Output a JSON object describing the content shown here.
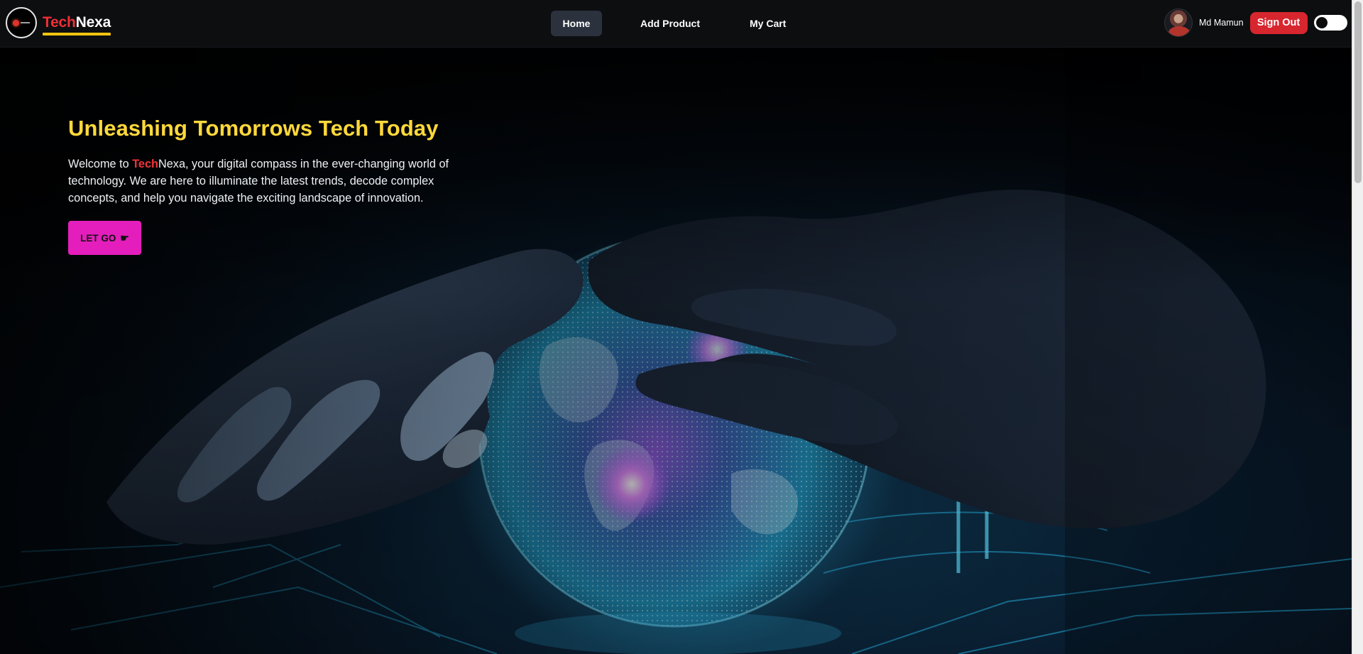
{
  "navbar": {
    "brand": {
      "part1": "Tech",
      "part2": "Nexa",
      "logo_icon": "technexa-logo-icon"
    },
    "links": [
      {
        "label": "Home",
        "active": true
      },
      {
        "label": "Add Product",
        "active": false
      },
      {
        "label": "My Cart",
        "active": false
      }
    ],
    "user": {
      "name": "Md Mamun",
      "avatar_icon": "user-avatar"
    },
    "signout_label": "Sign Out",
    "theme_toggle": {
      "icon": "theme-toggle-switch",
      "on": false
    }
  },
  "hero": {
    "title": "Unleashing Tomorrows Tech Today",
    "text_before": "Welcome to ",
    "text_highlight": "Tech",
    "text_after": "Nexa, your digital compass in the ever-changing world of technology. We are here to illuminate the latest trends, decode complex concepts, and help you navigate the exciting landscape of innovation.",
    "cta_label": "LET GO",
    "cta_icon": "pointing-hand-icon",
    "background_image": "glowing-digital-globe-held-by-hands"
  },
  "colors": {
    "brand_red": "#ef2f37",
    "brand_yellow": "#f1c40f",
    "title_yellow": "#ffd93a",
    "cta_magenta": "#e41ebc",
    "signout_red": "#d7262e",
    "nav_bg": "#0d0e10",
    "active_tab_bg": "#2b323d"
  }
}
